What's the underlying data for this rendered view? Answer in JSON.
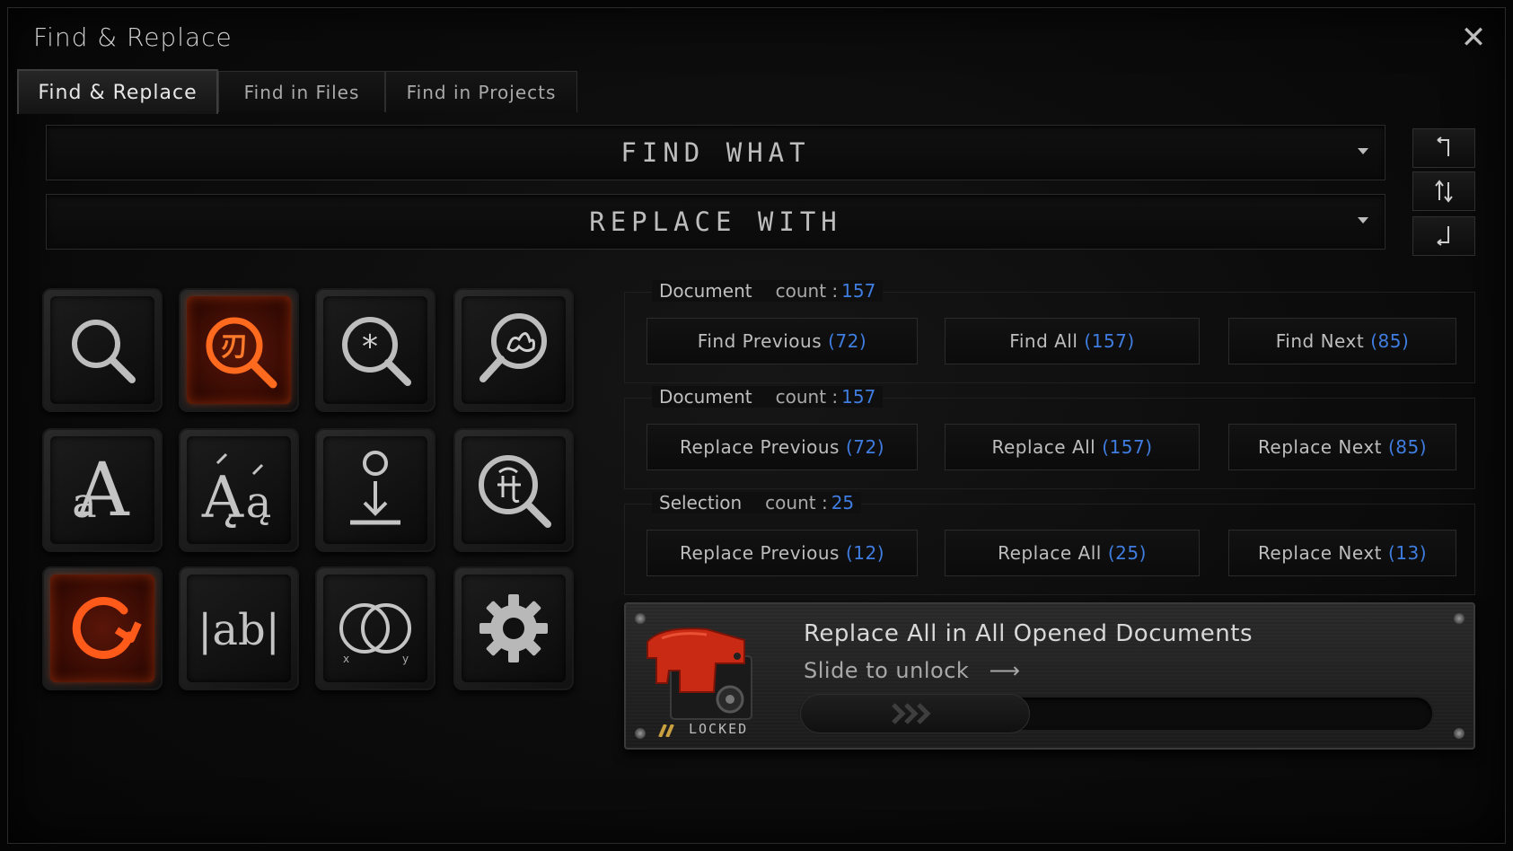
{
  "window": {
    "title": "Find & Replace"
  },
  "tabs": [
    {
      "label": "Find & Replace",
      "active": true
    },
    {
      "label": "Find in Files",
      "active": false
    },
    {
      "label": "Find in Projects",
      "active": false
    }
  ],
  "find": {
    "placeholder": "FIND WHAT"
  },
  "replace": {
    "placeholder": "REPLACE WITH"
  },
  "side_buttons": [
    "return-up-icon",
    "swap-vertical-icon",
    "return-down-icon"
  ],
  "tiles": [
    {
      "name": "search-icon",
      "active": false
    },
    {
      "name": "regex-search-icon",
      "active": true
    },
    {
      "name": "wildcard-search-icon",
      "active": false
    },
    {
      "name": "fuzzy-search-icon",
      "active": false
    },
    {
      "name": "match-case-icon",
      "active": false
    },
    {
      "name": "match-diacritics-icon",
      "active": false
    },
    {
      "name": "search-down-icon",
      "active": false
    },
    {
      "name": "unicode-search-icon",
      "active": false
    },
    {
      "name": "wrap-around-icon",
      "active": true
    },
    {
      "name": "whole-word-icon",
      "active": false
    },
    {
      "name": "extended-mode-icon",
      "active": false
    },
    {
      "name": "settings-icon",
      "active": false
    }
  ],
  "groups": [
    {
      "scope": "Document",
      "count_label": "count :",
      "count": "157",
      "buttons": [
        {
          "label": "Find Previous",
          "n": "(72)"
        },
        {
          "label": "Find All",
          "n": "(157)"
        },
        {
          "label": "Find Next",
          "n": "(85)"
        }
      ]
    },
    {
      "scope": "Document",
      "count_label": "count :",
      "count": "157",
      "buttons": [
        {
          "label": "Replace Previous",
          "n": "(72)"
        },
        {
          "label": "Replace All",
          "n": "(157)"
        },
        {
          "label": "Replace Next",
          "n": "(85)"
        }
      ]
    },
    {
      "scope": "Selection",
      "count_label": "count :",
      "count": "25",
      "buttons": [
        {
          "label": "Replace Previous",
          "n": "(12)"
        },
        {
          "label": "Replace All",
          "n": "(25)"
        },
        {
          "label": "Replace Next",
          "n": "(13)"
        }
      ]
    }
  ],
  "lock": {
    "title": "Replace All in All Opened Documents",
    "hint": "Slide to unlock",
    "state": "LOCKED",
    "slider_value": 0,
    "accent": "#d8341a"
  },
  "colors": {
    "count": "#3f7de0",
    "hot": "#ff5a1a"
  }
}
